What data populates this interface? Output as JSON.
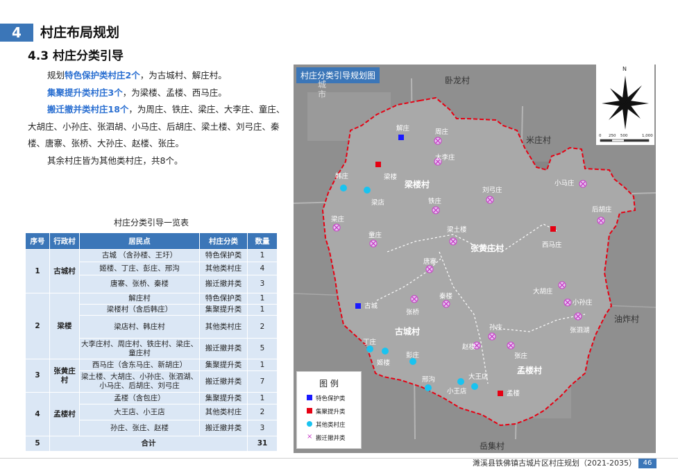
{
  "section": {
    "number": "4",
    "title": "村庄布局规划"
  },
  "subsection": "4.3 村庄分类引导",
  "intro": {
    "l1_pre": "规划",
    "l1_hl": "特色保护类村庄2个",
    "l1_post": "，为古城村、解庄村。",
    "l2_hl": "集聚提升类村庄3个",
    "l2_post": "，为梁楼、孟楼、西马庄。",
    "l3_hl": "搬迁撤并类村庄18个",
    "l3_post": "，为周庄、铁庄、梁庄、大李庄、童庄、大胡庄、小孙庄、张泗胡、小马庄、后胡庄、梁土楼、刘弓庄、秦楼、唐寨、张桥、大孙庄、赵楼、张庄。",
    "l4": "其余村庄皆为其他类村庄，共8个。"
  },
  "table": {
    "caption": "村庄分类引导一览表",
    "headers": [
      "序号",
      "行政村",
      "居民点",
      "村庄分类",
      "数量"
    ],
    "groups": [
      {
        "no": "1",
        "village": "古城村",
        "rows": [
          {
            "pt": "古城 （含孙楼、王圩）",
            "cls": "特色保护类",
            "n": "1"
          },
          {
            "pt": "姬楼、丁庄、彭庄、邢沟",
            "cls": "其他类村庄",
            "n": "4"
          },
          {
            "pt": "唐寨、张桥、秦楼",
            "cls": "搬迁撤并类",
            "n": "3"
          }
        ]
      },
      {
        "no": "2",
        "village": "梁楼",
        "rows": [
          {
            "pt": "解庄村",
            "cls": "特色保护类",
            "n": "1"
          },
          {
            "pt": "梁楼村（含后韩庄）",
            "cls": "集聚提升类",
            "n": "1"
          },
          {
            "pt": "梁店村、韩庄村",
            "cls": "其他类村庄",
            "n": "2"
          },
          {
            "pt": "大李庄村、周庄村、铁庄村、梁庄、童庄村",
            "cls": "搬迁撤并类",
            "n": "5"
          }
        ]
      },
      {
        "no": "3",
        "village": "张黄庄村",
        "rows": [
          {
            "pt": "西马庄（含东马庄、新胡庄）",
            "cls": "集聚提升类",
            "n": "1"
          },
          {
            "pt": "梁土楼、大胡庄、小孙庄、张泗湖、小马庄、后胡庄、刘弓庄",
            "cls": "搬迁撤并类",
            "n": "7"
          }
        ]
      },
      {
        "no": "4",
        "village": "孟楼村",
        "rows": [
          {
            "pt": "孟楼（含包庄）",
            "cls": "集聚提升类",
            "n": "1"
          },
          {
            "pt": "大王店、小王店",
            "cls": "其他类村庄",
            "n": "2"
          },
          {
            "pt": "孙庄、张庄、赵楼",
            "cls": "搬迁撤并类",
            "n": "3"
          }
        ]
      }
    ],
    "total": {
      "no": "5",
      "label": "合计",
      "n": "31"
    }
  },
  "map": {
    "title": "村庄分类引导规划图",
    "surroundings": [
      "卧龙村",
      "米庄村",
      "油炸村",
      "岳集村",
      "城",
      "市"
    ],
    "admin": [
      "梁楼村",
      "张黄庄村",
      "古城村",
      "孟楼村"
    ],
    "villages": {
      "blue": [
        "解庄",
        "古城"
      ],
      "red": [
        "梁楼",
        "西马庄",
        "孟楼"
      ],
      "cyan": [
        "韩庄",
        "梁店",
        "丁庄",
        "姬楼",
        "彭庄",
        "邢沟",
        "小王店",
        "大王店"
      ],
      "x": [
        "周庄",
        "大李庄",
        "刘弓庄",
        "小马庄",
        "后胡庄",
        "铁庄",
        "梁庄",
        "童庄",
        "梁土楼",
        "唐寨",
        "秦楼",
        "张桥",
        "大胡庄",
        "小孙庄",
        "张泗湖",
        "孙庄",
        "赵楼",
        "张庄"
      ]
    },
    "legend": {
      "title": "图 例",
      "items": [
        "特色保护类",
        "集聚提升类",
        "其他类村庄",
        "搬迁撤并类"
      ]
    },
    "scale": [
      "0",
      "250",
      "500",
      "1,000"
    ],
    "north": "N",
    "colors": {
      "special": "#1a1aff",
      "gather": "#e60012",
      "other": "#19c3f0",
      "relocate": "#c83cc8",
      "boundary": "#e60012"
    }
  },
  "footer": {
    "doc": "濉溪县铁佛镇古城片区村庄规划（2021-2035）",
    "page": "46"
  }
}
